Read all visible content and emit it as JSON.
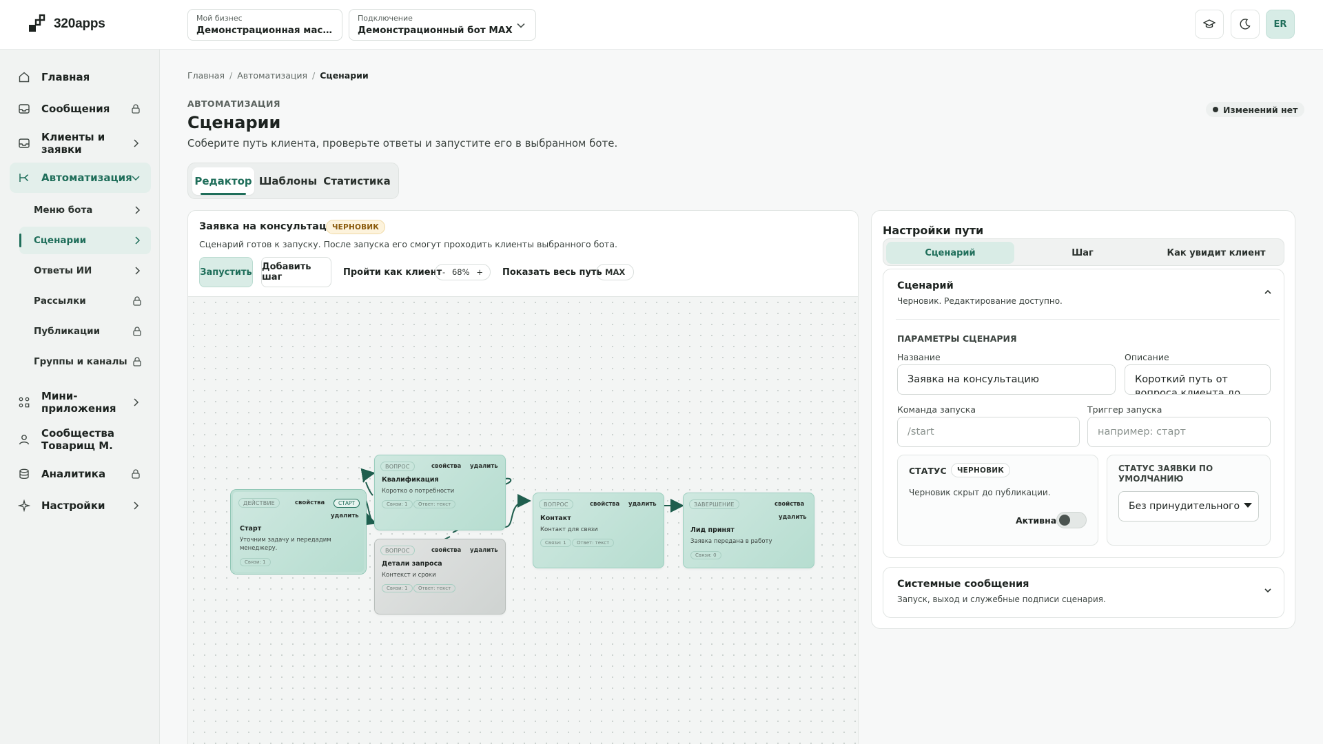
{
  "app": {
    "name": "320apps"
  },
  "header": {
    "business": {
      "label": "Мой бизнес",
      "value": "Демонстрационная мастер..."
    },
    "connection": {
      "label": "Подключение",
      "value": "Демонстрационный бот MAX"
    },
    "avatar": "ER"
  },
  "sidebar": {
    "items": [
      {
        "label": "Главная"
      },
      {
        "label": "Сообщения"
      },
      {
        "label": "Клиенты и заявки"
      },
      {
        "label": "Автоматизация"
      },
      {
        "label": "Мини-приложения"
      },
      {
        "label": "Сообщества Товарищ М."
      },
      {
        "label": "Аналитика"
      },
      {
        "label": "Настройки"
      }
    ],
    "sub": [
      {
        "label": "Меню бота"
      },
      {
        "label": "Сценарии"
      },
      {
        "label": "Ответы ИИ"
      },
      {
        "label": "Рассылки"
      },
      {
        "label": "Публикации"
      },
      {
        "label": "Группы и каналы"
      }
    ]
  },
  "breadcrumbs": [
    "Главная",
    "Автоматизация",
    "Сценарии"
  ],
  "page": {
    "eyebrow": "АВТОМАТИЗАЦИЯ",
    "title": "Сценарии",
    "description": "Соберите путь клиента, проверьте ответы и запустите его в выбранном боте.",
    "changes": "Изменений нет"
  },
  "tabs": [
    "Редактор",
    "Шаблоны",
    "Статистика"
  ],
  "editor": {
    "title": "Заявка на консультацию",
    "badge": "ЧЕРНОВИК",
    "description": "Сценарий готов к запуску. После запуска его смогут проходить клиенты выбранного бота.",
    "launch": "Запустить",
    "add_step": "Добавить шаг",
    "walk": "Пройти как клиент",
    "zoom_minus": "-",
    "zoom": "68%",
    "zoom_plus": "+",
    "show_path": "Показать весь путь",
    "channel": "MAX"
  },
  "nodes": [
    {
      "type": "ДЕЙСТВИЕ",
      "props": "свойства",
      "start": "СТАРТ",
      "delete": "удалить",
      "name": "Старт",
      "desc": "Уточним задачу и передадим менеджеру.",
      "links": "Связи: 1"
    },
    {
      "type": "ВОПРОС",
      "props": "свойства",
      "delete": "удалить",
      "name": "Квалификация",
      "desc": "Коротко о потребности",
      "links": "Связи: 1",
      "answer": "Ответ: текст"
    },
    {
      "type": "ВОПРОС",
      "props": "свойства",
      "delete": "удалить",
      "name": "Детали запроса",
      "desc": "Контекст и сроки",
      "links": "Связи: 1",
      "answer": "Ответ: текст"
    },
    {
      "type": "ВОПРОС",
      "props": "свойства",
      "delete": "удалить",
      "name": "Контакт",
      "desc": "Контакт для связи",
      "links": "Связи: 1",
      "answer": "Ответ: текст"
    },
    {
      "type": "ЗАВЕРШЕНИЕ",
      "props": "свойства",
      "delete": "удалить",
      "name": "Лид принят",
      "desc": "Заявка передана в работу",
      "links": "Связи: 0"
    }
  ],
  "panel": {
    "title": "Настройки пути",
    "tabs": [
      "Сценарий",
      "Шаг",
      "Как увидит клиент"
    ],
    "scenario": {
      "title": "Сценарий",
      "subtitle": "Черновик. Редактирование доступно.",
      "params": "ПАРАМЕТРЫ СЦЕНАРИЯ",
      "name_label": "Название",
      "name_value": "Заявка на консультацию",
      "desc_label": "Описание",
      "desc_value": "Короткий путь от вопроса клиента до",
      "cmd_label": "Команда запуска",
      "cmd_placeholder": "/start",
      "trigger_label": "Триггер запуска",
      "trigger_placeholder": "например: старт",
      "status_label": "СТАТУС",
      "status_badge": "ЧЕРНОВИК",
      "status_text": "Черновик скрыт до публикации.",
      "active_label": "Активна",
      "request_status_label": "СТАТУС ЗАЯВКИ ПО УМОЛЧАНИЮ",
      "request_status_value": "Без принудительного"
    },
    "system": {
      "title": "Системные сообщения",
      "subtitle": "Запуск, выход и служебные подписи сценария."
    }
  }
}
